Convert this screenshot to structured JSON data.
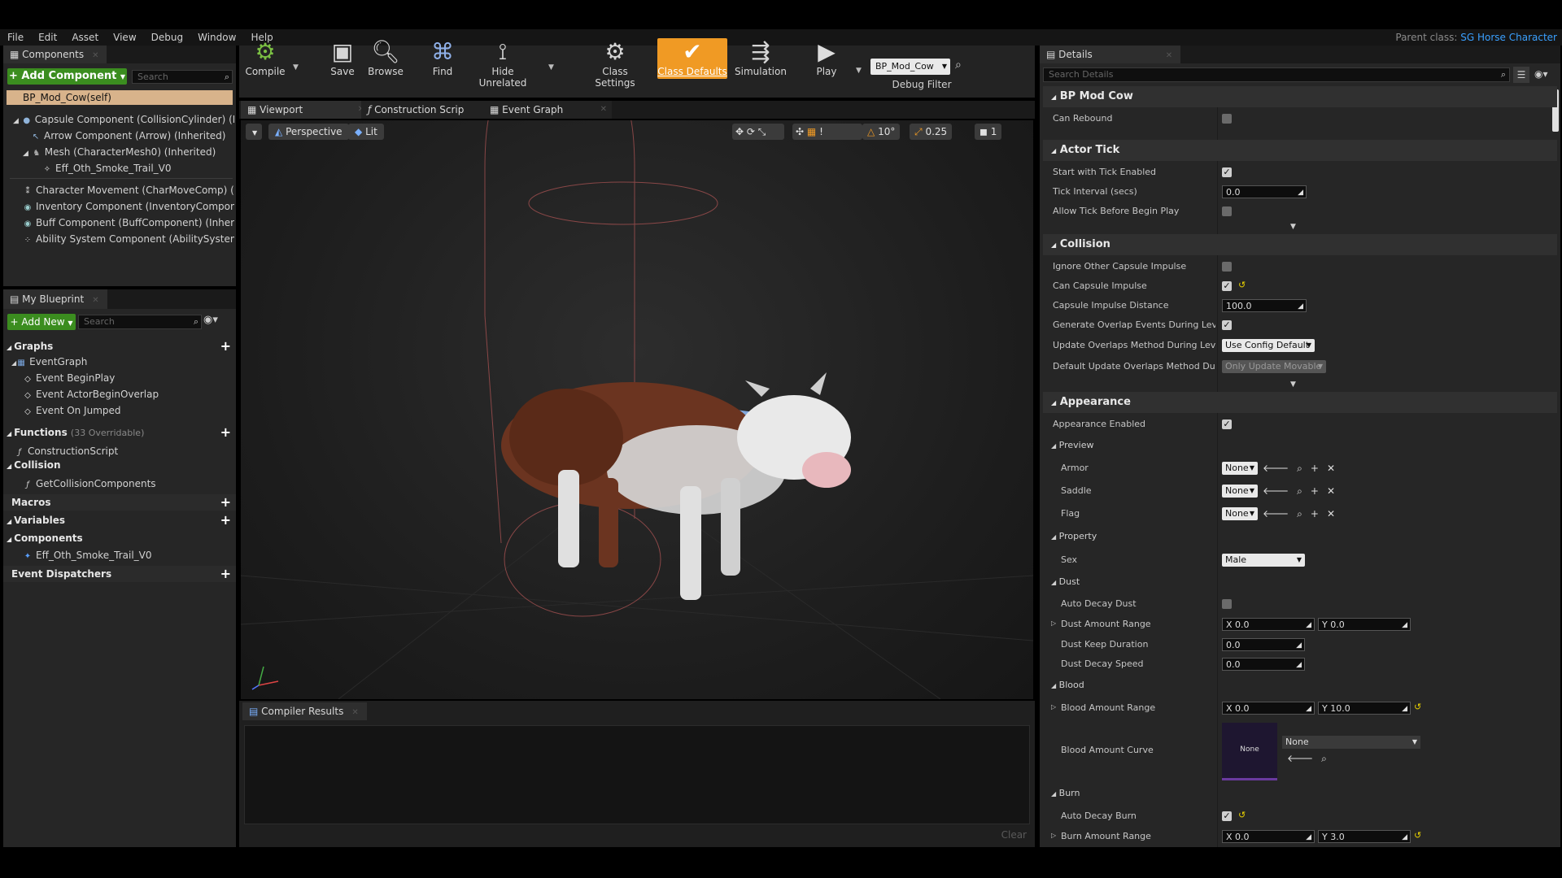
{
  "menu": [
    "File",
    "Edit",
    "Asset",
    "View",
    "Debug",
    "Window",
    "Help"
  ],
  "parent_class": {
    "label": "Parent class:",
    "value": "SG Horse Character"
  },
  "components_panel": {
    "tab": "Components",
    "add_label": "+ Add Component",
    "search_placeholder": "Search",
    "self_label": "BP_Mod_Cow(self)",
    "items": [
      "Capsule Component (CollisionCylinder) (Inhe",
      "Arrow Component (Arrow) (Inherited)",
      "Mesh (CharacterMesh0) (Inherited)",
      "Eff_Oth_Smoke_Trail_V0",
      "Character Movement (CharMoveComp) (Inhe",
      "Inventory Component (InventoryComponent)",
      "Buff Component (BuffComponent) (Inherited",
      "Ability System Component (AbilitySystemCor"
    ]
  },
  "my_blueprint": {
    "tab": "My Blueprint",
    "add_label": "+ Add New",
    "search_placeholder": "Search",
    "graphs_label": "Graphs",
    "event_graph": "EventGraph",
    "events": [
      "Event BeginPlay",
      "Event ActorBeginOverlap",
      "Event On Jumped"
    ],
    "functions_label": "Functions",
    "functions_count": "(33 Overridable)",
    "construction_script": "ConstructionScript",
    "collision_label": "Collision",
    "get_collision": "GetCollisionComponents",
    "macros_label": "Macros",
    "variables_label": "Variables",
    "components_label": "Components",
    "component_var": "Eff_Oth_Smoke_Trail_V0",
    "dispatchers_label": "Event Dispatchers"
  },
  "toolbar": {
    "compile": "Compile",
    "save": "Save",
    "browse": "Browse",
    "find": "Find",
    "hide_unrelated": "Hide Unrelated",
    "class_settings": "Class Settings",
    "class_defaults": "Class Defaults",
    "simulation": "Simulation",
    "play": "Play",
    "debug_object": "BP_Mod_Cow",
    "debug_filter": "Debug Filter"
  },
  "editor_tabs": [
    "Viewport",
    "Construction Scrip",
    "Event Graph"
  ],
  "viewport": {
    "perspective": "Perspective",
    "lit": "Lit",
    "angle": "10°",
    "scale": "0.25",
    "camera_speed": "1"
  },
  "compiler": {
    "tab": "Compiler Results",
    "clear": "Clear"
  },
  "details": {
    "tab": "Details",
    "search_placeholder": "Search Details",
    "sections": {
      "bp": "BP Mod Cow",
      "tick": "Actor Tick",
      "collision": "Collision",
      "appearance": "Appearance"
    },
    "can_rebound": "Can Rebound",
    "start_tick": "Start with Tick Enabled",
    "tick_interval": "Tick Interval (secs)",
    "tick_interval_val": "0.0",
    "allow_tick": "Allow Tick Before Begin Play",
    "ignore_capsule": "Ignore Other Capsule Impulse",
    "can_capsule": "Can Capsule Impulse",
    "capsule_dist": "Capsule Impulse Distance",
    "capsule_dist_val": "100.0",
    "gen_overlap": "Generate Overlap Events During Level St",
    "update_overlaps": "Update Overlaps Method During Level St",
    "update_overlaps_val": "Use Config Default",
    "default_update": "Default Update Overlaps Method During",
    "default_update_val": "Only Update Movable",
    "appearance_enabled": "Appearance Enabled",
    "preview": "Preview",
    "armor": "Armor",
    "saddle": "Saddle",
    "flag": "Flag",
    "none": "None",
    "property": "Property",
    "sex": "Sex",
    "sex_val": "Male",
    "dust": "Dust",
    "auto_decay_dust": "Auto Decay Dust",
    "dust_range": "Dust Amount Range",
    "dust_x": "0.0",
    "dust_y": "0.0",
    "dust_keep": "Dust Keep Duration",
    "dust_keep_val": "0.0",
    "dust_decay": "Dust Decay Speed",
    "dust_decay_val": "0.0",
    "blood": "Blood",
    "blood_range": "Blood Amount Range",
    "blood_x": "0.0",
    "blood_y": "10.0",
    "blood_curve": "Blood Amount Curve",
    "curve_thumb": "None",
    "curve_val": "None",
    "burn": "Burn",
    "auto_decay_burn": "Auto Decay Burn",
    "burn_range": "Burn Amount Range",
    "burn_x": "0.0",
    "burn_y": "3.0",
    "x": "X",
    "y": "Y"
  }
}
